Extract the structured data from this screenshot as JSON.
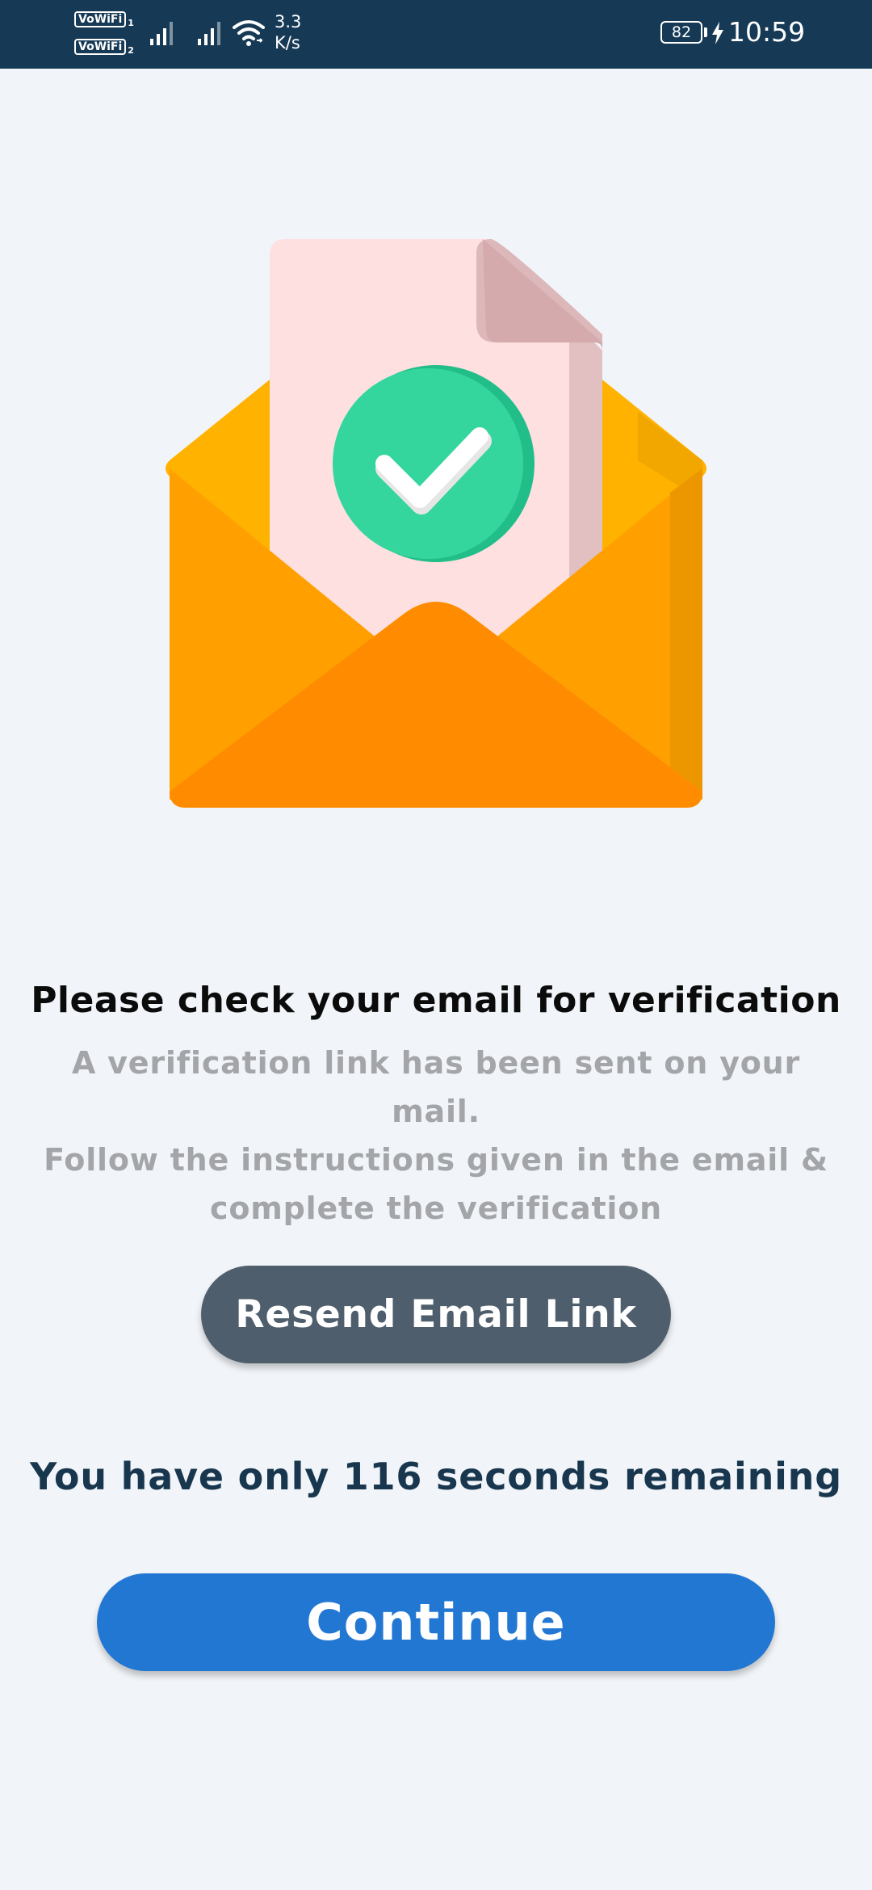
{
  "status_bar": {
    "sim1_label": "VoWiFi",
    "sim1_index": "1",
    "sim2_label": "VoWiFi",
    "sim2_index": "2",
    "net_speed_value": "3.3",
    "net_speed_unit": "K/s",
    "battery_level": "82",
    "time": "10:59",
    "icons": [
      "signal-icon",
      "signal-icon",
      "wifi-icon",
      "battery-icon",
      "charging-bolt-icon"
    ],
    "background_color": "#163a56"
  },
  "illustration": {
    "icon": "email-verified-envelope-icon",
    "colors": {
      "envelope_back": "#ffb300",
      "envelope_front": "#ff9f00",
      "envelope_flap": "#ff8c00",
      "paper": "#ffe0e1",
      "check_circle": "#34d69d"
    }
  },
  "content": {
    "heading": "Please check your email for verification",
    "description_lines": [
      "A verification link has been sent on your mail.",
      "Follow the instructions given in the email &",
      "complete the verification"
    ]
  },
  "resend_button": {
    "label": "Resend Email Link",
    "color": "#4f5e6c"
  },
  "timer": {
    "text": "You have only 116 seconds remaining",
    "seconds_remaining": 116
  },
  "continue_button": {
    "label": "Continue",
    "color": "#2277d3"
  }
}
